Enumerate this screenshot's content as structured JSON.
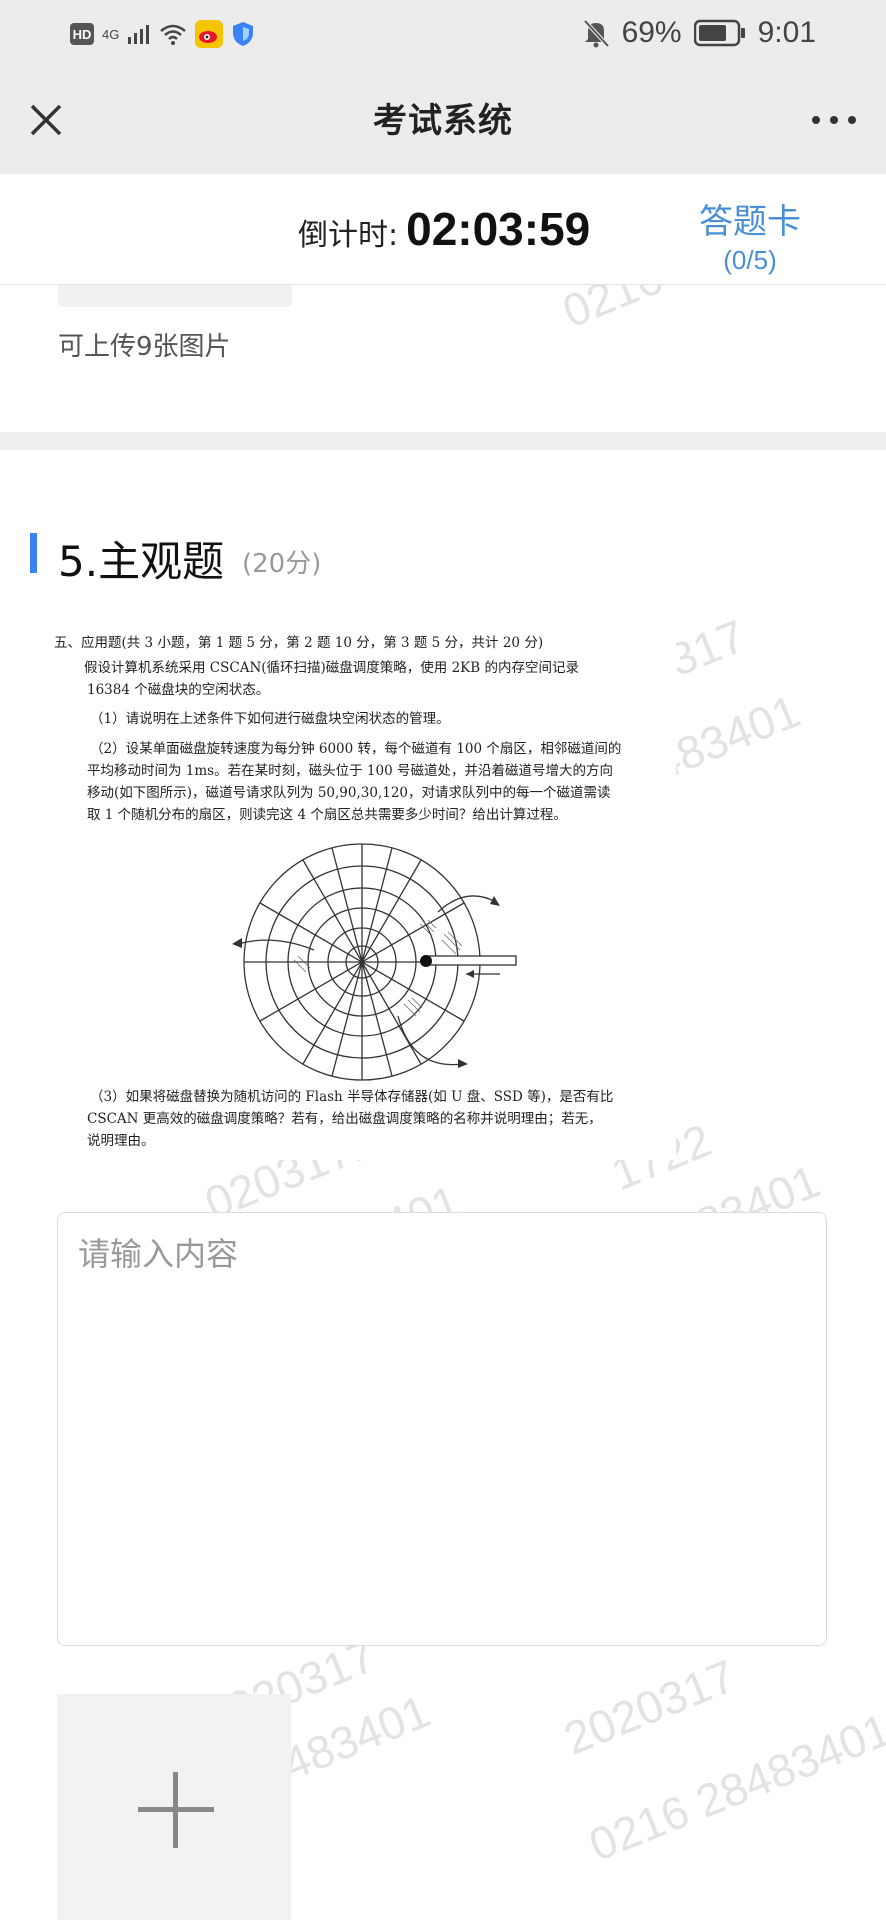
{
  "status_bar": {
    "badge": "HD",
    "network": "4G",
    "battery": "69%",
    "time": "9:01"
  },
  "header": {
    "title": "考试系统",
    "close_icon": "close-icon",
    "more_icon": "more-dots-icon"
  },
  "timer": {
    "label": "倒计时:",
    "value": "02:03:59"
  },
  "answer_card": {
    "label": "答题卡",
    "count": "(0/5)"
  },
  "previous_question": {
    "upload_hint": "可上传9张图片"
  },
  "question": {
    "number_title": "5.主观题",
    "score": "(20分)",
    "image_lines": [
      "五、应用题(共 3 小题，第 1 题 5 分，第 2 题 10 分，第 3 题 5 分，共计 20 分)",
      "假设计算机系统采用 CSCAN(循环扫描)磁盘调度策略，使用 2KB 的内存空间记录",
      "16384 个磁盘块的空闲状态。",
      "（1）请说明在上述条件下如何进行磁盘块空闲状态的管理。",
      "（2）设某单面磁盘旋转速度为每分钟 6000 转，每个磁道有 100 个扇区，相邻磁道间的",
      "平均移动时间为 1ms。若在某时刻，磁头位于 100 号磁道处，并沿着磁道号增大的方向",
      "移动(如下图所示)，磁道号请求队列为 50,90,30,120，对请求队列中的每一个磁道需读",
      "取 1 个随机分布的扇区，则读完这 4 个扇区总共需要多少时间？给出计算过程。",
      "（3）如果将磁盘替换为随机访问的 Flash 半导体存储器(如 U 盘、SSD 等)，是否有比",
      "CSCAN 更高效的磁盘调度策略？若有，给出磁盘调度策略的名称并说明理由；若无，",
      "说明理由。"
    ]
  },
  "answer": {
    "placeholder": "请输入内容",
    "value": ""
  },
  "upload": {
    "icon": "plus-icon"
  },
  "watermarks": [
    "2020317",
    "1722",
    "02031722",
    "28483401",
    "0216 2848340",
    "2020317",
    "0216 28483401",
    "2020317",
    "0216 2848340"
  ]
}
